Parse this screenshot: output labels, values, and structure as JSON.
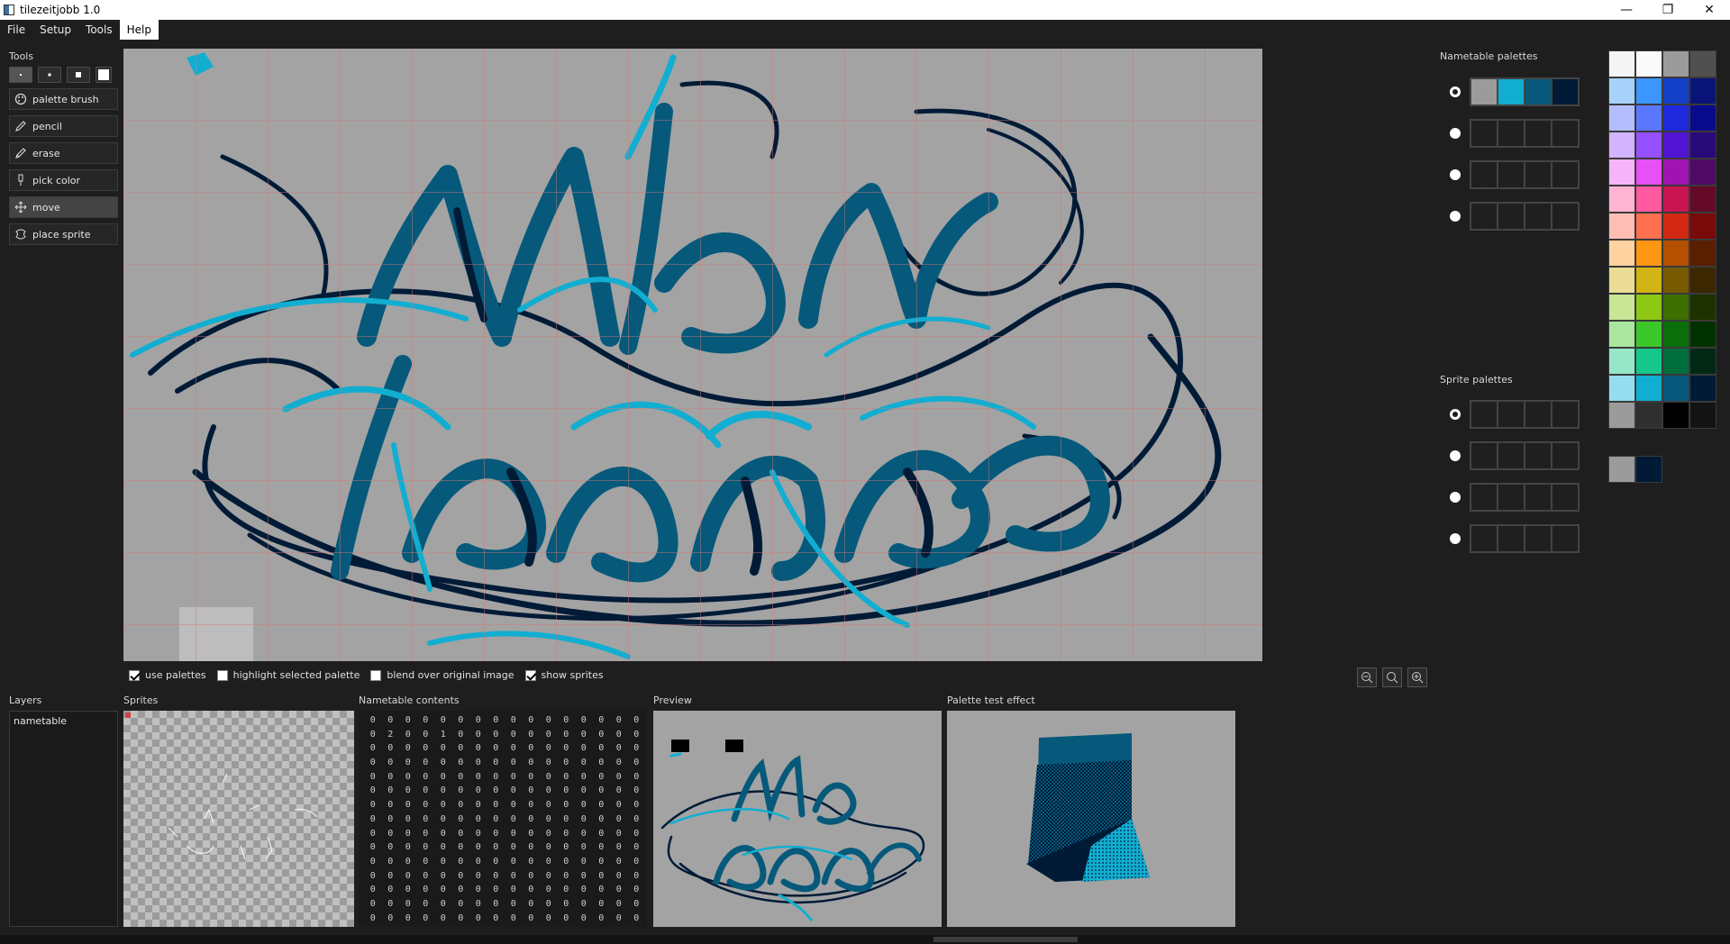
{
  "window": {
    "title": "tilezeitjobb 1.0",
    "minimize": "—",
    "restore": "❐",
    "close": "✕"
  },
  "menu": [
    "File",
    "Setup",
    "Tools",
    "Help"
  ],
  "tools": {
    "label": "Tools",
    "items": [
      {
        "label": "palette brush",
        "icon": "palette-icon"
      },
      {
        "label": "pencil",
        "icon": "pencil-icon"
      },
      {
        "label": "erase",
        "icon": "eraser-icon"
      },
      {
        "label": "pick color",
        "icon": "eyedropper-icon"
      },
      {
        "label": "move",
        "icon": "move-icon",
        "active": true
      },
      {
        "label": "place sprite",
        "icon": "sprite-icon"
      }
    ]
  },
  "options": {
    "use_palettes": "use palettes",
    "highlight_selected_palette": "highlight selected palette",
    "blend_over_original": "blend over original image",
    "show_sprites": "show sprites"
  },
  "panels": {
    "layers": "Layers",
    "sprites": "Sprites",
    "nametable_contents": "Nametable contents",
    "preview": "Preview",
    "palette_test_effect": "Palette test effect",
    "nametable_palettes": "Nametable palettes",
    "sprite_palettes": "Sprite palettes"
  },
  "layers": [
    "nametable"
  ],
  "nametable_rows": [
    [
      0,
      0,
      0,
      0,
      0,
      0,
      0,
      0,
      0,
      0,
      0,
      0,
      0,
      0,
      0,
      0
    ],
    [
      0,
      2,
      0,
      0,
      1,
      0,
      0,
      0,
      0,
      0,
      0,
      0,
      0,
      0,
      0,
      0
    ],
    [
      0,
      0,
      0,
      0,
      0,
      0,
      0,
      0,
      0,
      0,
      0,
      0,
      0,
      0,
      0,
      0
    ],
    [
      0,
      0,
      0,
      0,
      0,
      0,
      0,
      0,
      0,
      0,
      0,
      0,
      0,
      0,
      0,
      0
    ],
    [
      0,
      0,
      0,
      0,
      0,
      0,
      0,
      0,
      0,
      0,
      0,
      0,
      0,
      0,
      0,
      0
    ],
    [
      0,
      0,
      0,
      0,
      0,
      0,
      0,
      0,
      0,
      0,
      0,
      0,
      0,
      0,
      0,
      0
    ],
    [
      0,
      0,
      0,
      0,
      0,
      0,
      0,
      0,
      0,
      0,
      0,
      0,
      0,
      0,
      0,
      0
    ],
    [
      0,
      0,
      0,
      0,
      0,
      0,
      0,
      0,
      0,
      0,
      0,
      0,
      0,
      0,
      0,
      0
    ],
    [
      0,
      0,
      0,
      0,
      0,
      0,
      0,
      0,
      0,
      0,
      0,
      0,
      0,
      0,
      0,
      0
    ],
    [
      0,
      0,
      0,
      0,
      0,
      0,
      0,
      0,
      0,
      0,
      0,
      0,
      0,
      0,
      0,
      0
    ],
    [
      0,
      0,
      0,
      0,
      0,
      0,
      0,
      0,
      0,
      0,
      0,
      0,
      0,
      0,
      0,
      0
    ],
    [
      0,
      0,
      0,
      0,
      0,
      0,
      0,
      0,
      0,
      0,
      0,
      0,
      0,
      0,
      0,
      0
    ],
    [
      0,
      0,
      0,
      0,
      0,
      0,
      0,
      0,
      0,
      0,
      0,
      0,
      0,
      0,
      0,
      0
    ],
    [
      0,
      0,
      0,
      0,
      0,
      0,
      0,
      0,
      0,
      0,
      0,
      0,
      0,
      0,
      0,
      0
    ],
    [
      0,
      0,
      0,
      0,
      0,
      0,
      0,
      0,
      0,
      0,
      0,
      0,
      0,
      0,
      0,
      0
    ]
  ],
  "nametable_palettes": [
    [
      "#9b9b9b",
      "#11aed1",
      "#06597a",
      "#011b37"
    ],
    [
      "#1f1f1f",
      "#1f1f1f",
      "#1f1f1f",
      "#1f1f1f"
    ],
    [
      "#1f1f1f",
      "#1f1f1f",
      "#1f1f1f",
      "#1f1f1f"
    ],
    [
      "#1f1f1f",
      "#1f1f1f",
      "#1f1f1f",
      "#1f1f1f"
    ]
  ],
  "sprite_palettes": [
    [
      "#1f1f1f",
      "#1f1f1f",
      "#1f1f1f",
      "#1f1f1f"
    ],
    [
      "#1f1f1f",
      "#1f1f1f",
      "#1f1f1f",
      "#1f1f1f"
    ],
    [
      "#1f1f1f",
      "#1f1f1f",
      "#1f1f1f",
      "#1f1f1f"
    ],
    [
      "#1f1f1f",
      "#1f1f1f",
      "#1f1f1f",
      "#1f1f1f"
    ]
  ],
  "master_palette": [
    "#f5f5f5",
    "#fafafa",
    "#9b9b9b",
    "#505050",
    "#a8d2fa",
    "#3c96ff",
    "#1440c8",
    "#0a1478",
    "#b4beff",
    "#5a78ff",
    "#1e28dc",
    "#0a0a8c",
    "#d2b4ff",
    "#9650ff",
    "#5014d2",
    "#280a78",
    "#f5b4fa",
    "#e650f5",
    "#a014b4",
    "#500a64",
    "#ffb4d2",
    "#ff5aa0",
    "#c81450",
    "#640a28",
    "#ffbeb4",
    "#ff7050",
    "#d22814",
    "#780a0a",
    "#ffd2a0",
    "#ff9614",
    "#b45000",
    "#5a1e00",
    "#ebdc96",
    "#d2b414",
    "#785a00",
    "#3c2800",
    "#c8e696",
    "#8cc814",
    "#3c6e00",
    "#1e3200",
    "#aae6a0",
    "#3cc828",
    "#0a6e0a",
    "#003200",
    "#96e6c8",
    "#14c88c",
    "#006e3c",
    "#002814",
    "#96dcf0",
    "#11aed1",
    "#06597a",
    "#011b37",
    "#9b9b9b",
    "#303030",
    "#000000",
    "#141414"
  ],
  "selected_colors": [
    "#9b9b9b",
    "#011b37"
  ],
  "art_colors": {
    "light": "#11aed1",
    "mid": "#06597a",
    "dark": "#011b37",
    "bg": "#a3a3a3"
  }
}
